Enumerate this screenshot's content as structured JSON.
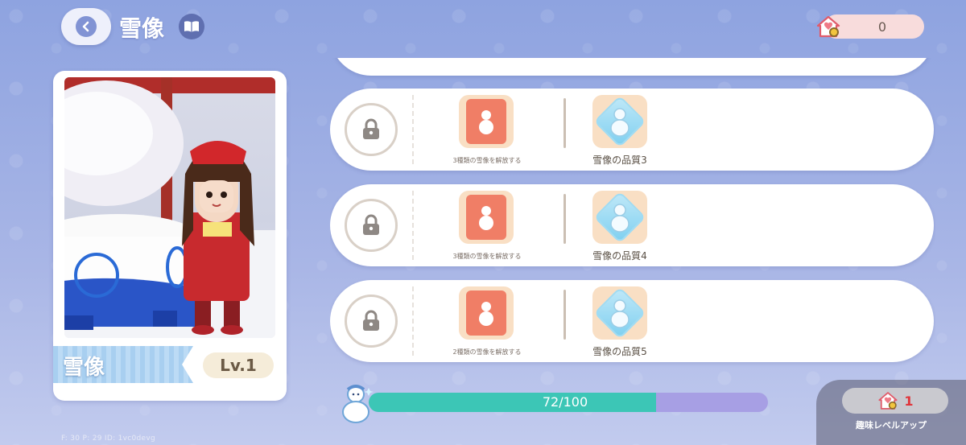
{
  "header": {
    "title": "雪像",
    "currency_value": "0"
  },
  "character": {
    "name": "雪像",
    "level": "Lv.1"
  },
  "rows": [
    {
      "condition": "3種類の雪像を解放する",
      "reward": "雪像の品質3"
    },
    {
      "condition": "3種類の雪像を解放する",
      "reward": "雪像の品質4"
    },
    {
      "condition": "2種類の雪像を解放する",
      "reward": "雪像の品質5"
    }
  ],
  "progress": {
    "label": "72/100",
    "current": 72,
    "max": 100
  },
  "levelup": {
    "count": "1",
    "label": "趣味レベルアップ"
  },
  "debug": "F: 30    P: 29    ID: 1vc0devg",
  "colors": {
    "progress_fill": "#3cc6b6",
    "progress_track": "#a79fe4",
    "card_bg": "#ffffff",
    "icon_bg": "#f9dfc4"
  }
}
